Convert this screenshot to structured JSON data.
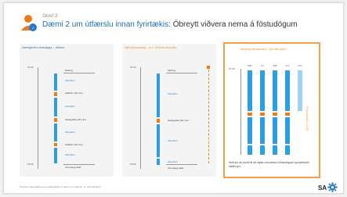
{
  "header": {
    "step": "Skref 3:",
    "title_main": "Dæmi 2 um útfærslu innan fyrirtækis: ",
    "title_rest": "Óbreytt viðvera nema á föstudögum"
  },
  "panels": [
    {
      "heading": "Dæmigerður vinnudagur – viðvera",
      "times": {
        "start": "07:30",
        "end": "15:30"
      },
      "items": {
        "maeting": "Mæting",
        "vinna1": "Vinnutími",
        "kaffi1": "Kaffitími (20 mín)",
        "vinna2": "Vinnutími",
        "hadegi": "Hádegishlé (30 mín)",
        "vinna3": "Vinnutími",
        "kaffi2": "Kaffitími (15 mín)",
        "vinna4": "Vinnutími",
        "lok": "Vinnudegi lokið"
      }
    },
    {
      "heading": "Nýtt fyrirkomulag – m.v. 36 tíma vinnuviku",
      "times": {
        "start": "07:30",
        "end": "15:00"
      },
      "items": {
        "maeting": "Mæting",
        "vinna1": "Vinnutími",
        "hadegi": "Hádegishlé (30 mín)",
        "vinna2": "Vinnutími",
        "vinna3": "Vinnutími",
        "lok": "Vinnudegi lokið"
      }
    },
    {
      "heading": "Skipting vinnutímans – yfir viku (klst.)",
      "time_start": "07:30",
      "days": [
        "Mán",
        "Þri",
        "Mið",
        "Fim",
        "Fös"
      ],
      "vertical_label": "Föstudagar 13:00",
      "note": "Skilt því að unnið til að stytta vinnutíma á föstudögum og starfsfólk hættir fyrr"
    }
  ],
  "footnote": "*Fyrirkomulag kaffitíma og hádegishlés er dæmi um útfærslu, en ekki bindandi",
  "logo_text": "SA",
  "colors": {
    "blue": "#2d9de2",
    "orange": "#ec7a1a",
    "title_blue": "#1f6fa8"
  }
}
